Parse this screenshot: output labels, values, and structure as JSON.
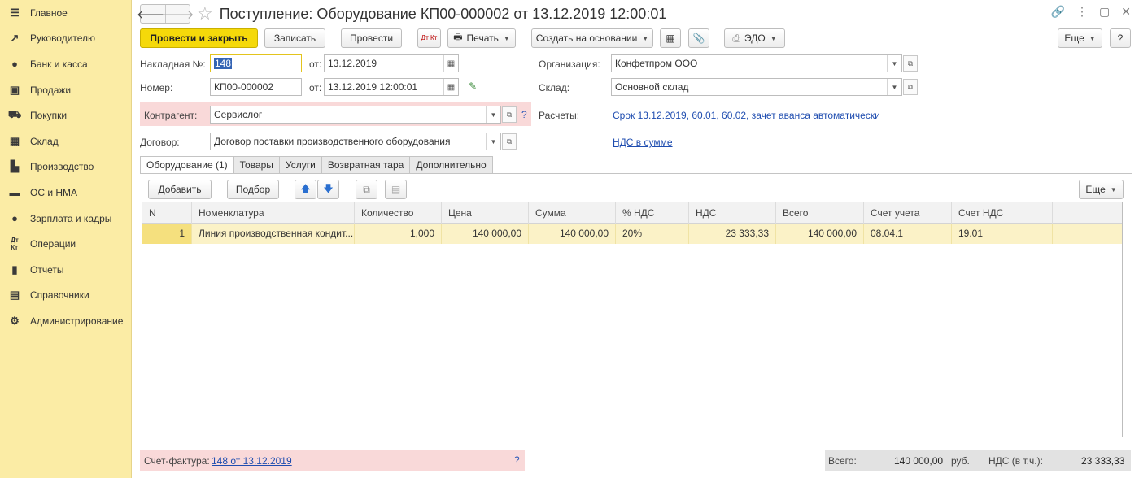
{
  "sidebar": {
    "items": [
      {
        "label": "Главное",
        "icon": "menu-icon"
      },
      {
        "label": "Руководителю",
        "icon": "trend-icon"
      },
      {
        "label": "Банк и касса",
        "icon": "coin-icon"
      },
      {
        "label": "Продажи",
        "icon": "bag-icon"
      },
      {
        "label": "Покупки",
        "icon": "cart-icon"
      },
      {
        "label": "Склад",
        "icon": "warehouse-icon"
      },
      {
        "label": "Производство",
        "icon": "factory-icon"
      },
      {
        "label": "ОС и НМА",
        "icon": "truck-icon"
      },
      {
        "label": "Зарплата и кадры",
        "icon": "person-icon"
      },
      {
        "label": "Операции",
        "icon": "dt-kt-icon"
      },
      {
        "label": "Отчеты",
        "icon": "bar-chart-icon"
      },
      {
        "label": "Справочники",
        "icon": "book-icon"
      },
      {
        "label": "Администрирование",
        "icon": "gear-icon"
      }
    ]
  },
  "header": {
    "title": "Поступление: Оборудование КП00-000002 от 13.12.2019 12:00:01"
  },
  "toolbar": {
    "post_close": "Провести и закрыть",
    "save": "Записать",
    "post": "Провести",
    "dtkt": "Дт Кт",
    "print": "Печать",
    "create_based": "Создать на основании",
    "edo": "ЭДО",
    "more": "Еще"
  },
  "form": {
    "invoice_label": "Накладная  №:",
    "invoice_value": "148",
    "from_label": "от:",
    "invoice_date": "13.12.2019",
    "number_label": "Номер:",
    "number_value": "КП00-000002",
    "number_date": "13.12.2019 12:00:01",
    "org_label": "Организация:",
    "org_value": "Конфетпром ООО",
    "warehouse_label": "Склад:",
    "warehouse_value": "Основной склад",
    "contractor_label": "Контрагент:",
    "contractor_value": "Сервислог",
    "question": "?",
    "settlements_label": "Расчеты:",
    "settlements_link": "Срок 13.12.2019, 60.01, 60.02, зачет аванса автоматически",
    "contract_label": "Договор:",
    "contract_value": "Договор поставки производственного оборудования",
    "vat_link": "НДС в сумме"
  },
  "tabs": [
    "Оборудование (1)",
    "Товары",
    "Услуги",
    "Возвратная тара",
    "Дополнительно"
  ],
  "table_toolbar": {
    "add": "Добавить",
    "pick": "Подбор",
    "more": "Еще"
  },
  "table": {
    "columns": [
      "N",
      "Номенклатура",
      "Количество",
      "Цена",
      "Сумма",
      "% НДС",
      "НДС",
      "Всего",
      "Счет учета",
      "Счет НДС"
    ],
    "rows": [
      [
        "1",
        "Линия производственная кондит...",
        "1,000",
        "140 000,00",
        "140 000,00",
        "20%",
        "23 333,33",
        "140 000,00",
        "08.04.1",
        "19.01"
      ]
    ]
  },
  "footer": {
    "invoice_label": "Счет-фактура:",
    "invoice_link": "148 от 13.12.2019",
    "question": "?",
    "total_label": "Всего:",
    "total_value": "140 000,00",
    "currency": "руб.",
    "vat_label": "НДС (в т.ч.):",
    "vat_value": "23 333,33"
  }
}
